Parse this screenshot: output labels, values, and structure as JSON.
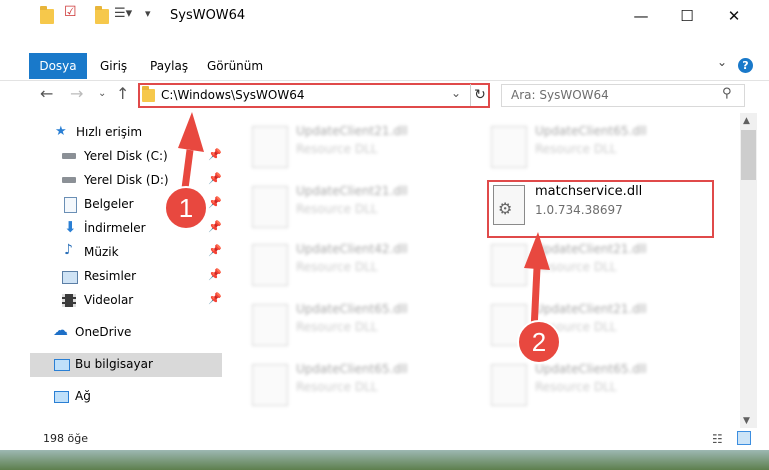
{
  "window": {
    "title": "SysWOW64",
    "minimize": "—",
    "maximize": "☐",
    "close": "✕"
  },
  "ribbon": {
    "tabs": [
      "Dosya",
      "Giriş",
      "Paylaş",
      "Görünüm"
    ],
    "help": "?"
  },
  "address": {
    "path": "C:\\Windows\\SysWOW64",
    "search_placeholder": "Ara: SysWOW64"
  },
  "sidebar": {
    "items": [
      {
        "label": "Hızlı erişim"
      },
      {
        "label": "Yerel Disk (C:)"
      },
      {
        "label": "Yerel Disk (D:)"
      },
      {
        "label": "Belgeler"
      },
      {
        "label": "İndirmeler"
      },
      {
        "label": "Müzik"
      },
      {
        "label": "Resimler"
      },
      {
        "label": "Videolar"
      },
      {
        "label": "OneDrive"
      },
      {
        "label": "Bu bilgisayar"
      },
      {
        "label": "Ağ"
      }
    ]
  },
  "files": [
    {
      "name": "UpdateClient21.dll",
      "sub": "Resource DLL"
    },
    {
      "name": "UpdateClient65.dll",
      "sub": "Resource DLL"
    },
    {
      "name": "UpdateClient21.dll",
      "sub": "Resource DLL"
    },
    {
      "name": "matchservice.dll",
      "sub": "1.0.734.38697"
    },
    {
      "name": "UpdateClient42.dll",
      "sub": "Resource DLL"
    },
    {
      "name": "UpdateClient21.dll",
      "sub": "Resource DLL"
    },
    {
      "name": "UpdateClient65.dll",
      "sub": "Resource DLL"
    },
    {
      "name": "UpdateClient21.dll",
      "sub": "Resource DLL"
    },
    {
      "name": "UpdateClient65.dll",
      "sub": "Resource DLL"
    },
    {
      "name": "UpdateClient65.dll",
      "sub": "Resource DLL"
    }
  ],
  "status": {
    "count": "198 öğe"
  },
  "annotations": {
    "step1": "1",
    "step2": "2",
    "color": "#e04a4a"
  }
}
